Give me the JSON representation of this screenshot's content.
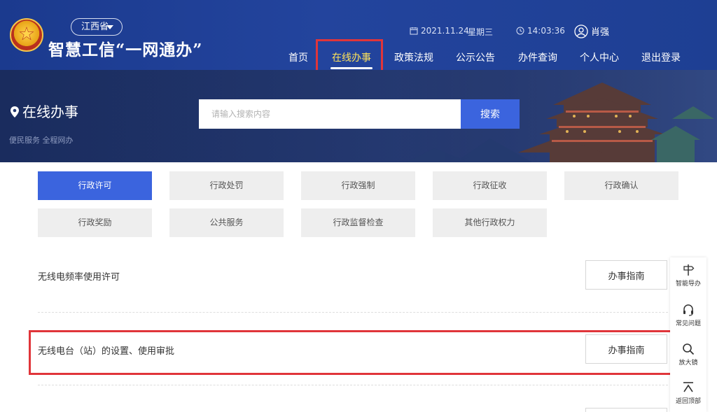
{
  "header": {
    "province": "江西省",
    "site_title": "智慧工信“一网通办”",
    "date": "2021.11.24",
    "weekday": "星期三",
    "time": "14:03:36",
    "username": "肖强"
  },
  "nav": [
    "首页",
    "在线办事",
    "政策法规",
    "公示公告",
    "办件查询",
    "个人中心",
    "退出登录"
  ],
  "banner": {
    "title": "在线办事",
    "subtitle": "便民服务 全程网办",
    "search_placeholder": "请输入搜索内容",
    "search_button": "搜索"
  },
  "categories": [
    "行政许可",
    "行政处罚",
    "行政强制",
    "行政征收",
    "行政确认",
    "行政奖励",
    "公共服务",
    "行政监督检查",
    "其他行政权力"
  ],
  "items": [
    {
      "title": "无线电频率使用许可",
      "button": "办事指南"
    },
    {
      "title": "无线电台（站）的设置、使用审批",
      "button": "办事指南"
    }
  ],
  "sidebar": {
    "guide": "智能导办",
    "faq": "常见问题",
    "magnifier": "放大镜",
    "top": "返回顶部"
  },
  "colors": {
    "header_bg": "#1f3f94",
    "accent": "#3b64de",
    "highlight": "#e0353a",
    "active_nav": "#ffe45a"
  }
}
